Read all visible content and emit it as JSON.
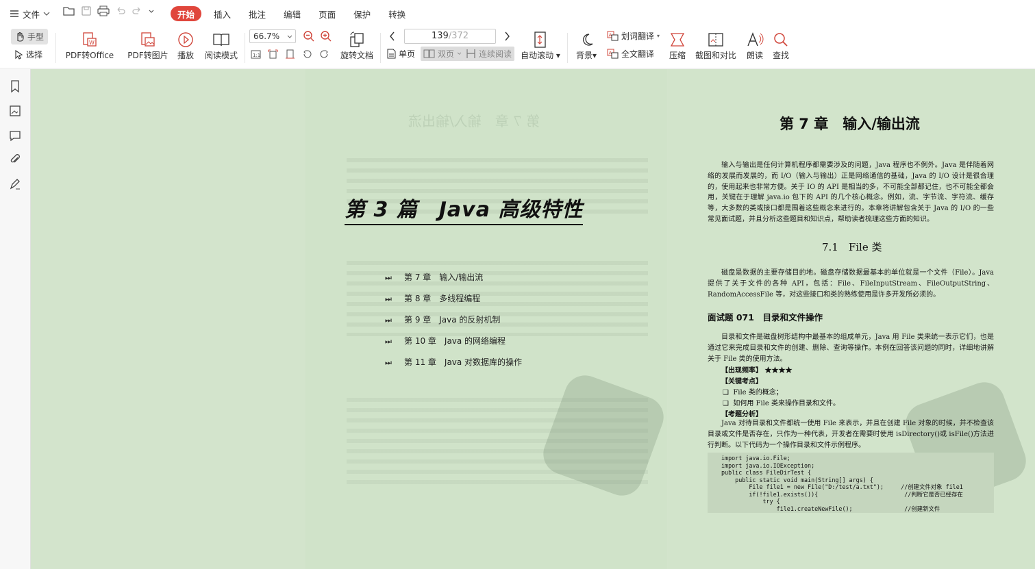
{
  "menubar": {
    "file_label": "文件",
    "tabs": [
      {
        "label": "开始",
        "active": true
      },
      {
        "label": "插入"
      },
      {
        "label": "批注"
      },
      {
        "label": "编辑"
      },
      {
        "label": "页面"
      },
      {
        "label": "保护"
      },
      {
        "label": "转换"
      }
    ]
  },
  "toolbar": {
    "hand_label": "手型",
    "select_label": "选择",
    "pdf_to_office": "PDF转Office",
    "pdf_to_image": "PDF转图片",
    "play": "播放",
    "read_mode": "阅读模式",
    "zoom": "66.7%",
    "rotate_doc": "旋转文档",
    "page_current": "139",
    "page_total": "/372",
    "single_page": "单页",
    "double_page": "双页",
    "continuous": "连续阅读",
    "auto_scroll": "自动滚动",
    "background": "背景",
    "word_translate": "划词翻译",
    "full_translate": "全文翻译",
    "compress": "压缩",
    "screenshot_compare": "截图和对比",
    "read_aloud": "朗读",
    "find": "查找"
  },
  "left_page": {
    "part_title": "第 3 篇　Java 高级特性",
    "toc": [
      "第 7 章　输入/输出流",
      "第 8 章　多线程编程",
      "第 9 章　Java 的反射机制",
      "第 10 章　Java 的网络编程",
      "第 11 章　Java 对数据库的操作"
    ]
  },
  "right_page": {
    "chapter_title": "第 7 章　输入/输出流",
    "intro": "输入与输出是任何计算机程序都需要涉及的问题，Java 程序也不例外。Java 是伴随着网络的发展而发展的，而 I/O（输入与输出）正是网络通信的基础，Java 的 I/O 设计是很合理的，使用起来也非常方便。关于 IO 的 API 是相当的多，不可能全部都记住，也不可能全都会用，关键在于理解 java.io 包下的 API 的几个核心概念。例如，流、字节流、字符流、缓存等，大多数的类或接口都是围着这些概念来进行的。本章将讲解包含关于 Java 的 I/O 的一些常见面试题，并且分析这些题目和知识点，帮助读者梳理这些方面的知识。",
    "section": "7.1　File 类",
    "section_para": "磁盘是数据的主要存储目的地。磁盘存储数据最基本的单位就是一个文件（File）。Java 提供了关于文件的各种 API，包括：File、FileInputStream、FileOutputString、RandomAccessFile 等，对这些接口和类的熟练使用是许多开发所必须的。",
    "question": "面试题 071　目录和文件操作",
    "question_para": "目录和文件是磁盘树形结构中最基本的组成单元，Java 用 File 类来统一表示它们，也是通过它来完成目录和文件的创建、删除、查询等操作。本例在回答该问题的同时，详细地讲解关于 File 类的使用方法。",
    "freq": "【出现频率】 ★★★★",
    "key_title": "【关键考点】",
    "key_items": [
      "File 类的概念；",
      "如何用 File 类来操作目录和文件。"
    ],
    "analysis_title": "【考题分析】",
    "analysis": "Java 对待目录和文件都统一使用 File 来表示，并且在创建 File 对象的时候，并不检查该目录或文件是否存在，只作为一种代表，开发者在需要时使用 isDirectory()或 isFile()方法进行判断。以下代码为一个操作目录和文件示例程序。",
    "code": "import java.io.File;\nimport java.io.IOException;\npublic class FileDirTest {\n    public static void main(String[] args) {\n        File file1 = new File(\"D:/test/a.txt\");     //创建文件对象 file1\n        if(!file1.exists()){                         //判断它是否已经存在\n            try {\n                file1.createNewFile();               //创建新文件"
  },
  "colors": {
    "accent": "#e0463c",
    "page_bg": "#d3e4cc"
  }
}
